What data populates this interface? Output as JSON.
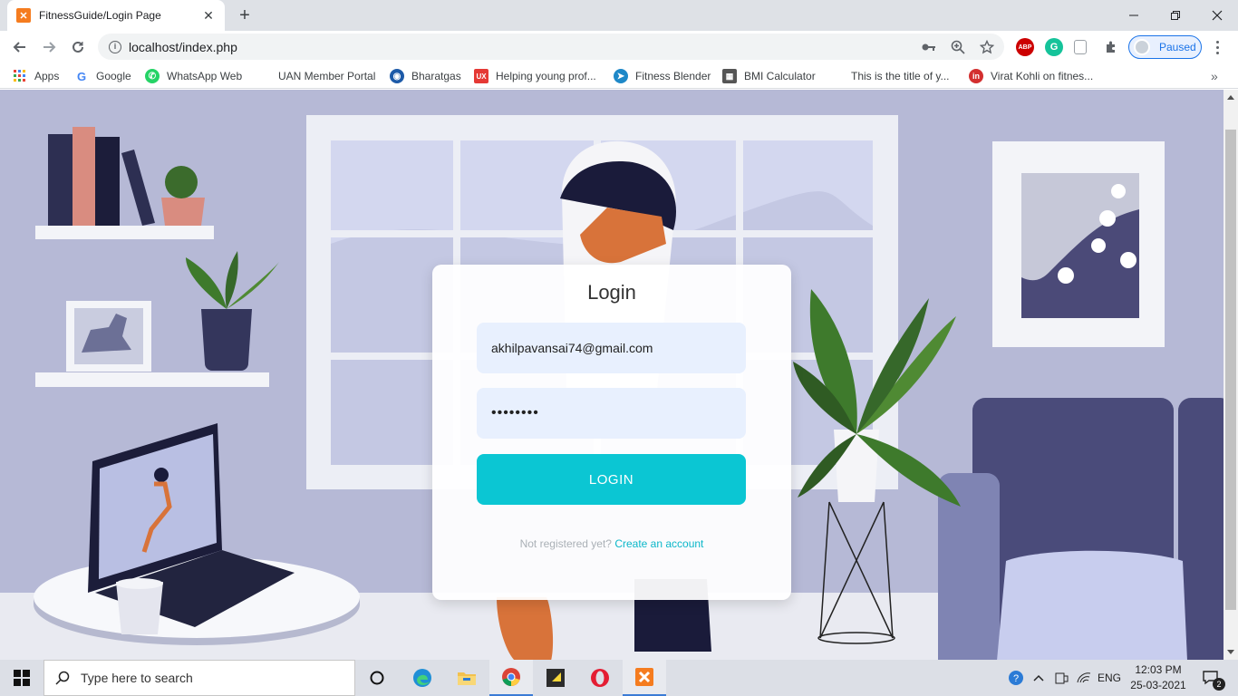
{
  "browser": {
    "tab_title": "FitnessGuide/Login Page",
    "tab_favicon": "xampp-icon",
    "url": "localhost/index.php",
    "profile_status": "Paused",
    "extensions": [
      "abp-icon",
      "grammarly-icon",
      "clipboard-icon",
      "puzzle-icon"
    ]
  },
  "bookmarks": [
    {
      "label": "Apps",
      "icon": "apps-grid-icon"
    },
    {
      "label": "Google",
      "icon": "google-icon"
    },
    {
      "label": "WhatsApp Web",
      "icon": "whatsapp-icon"
    },
    {
      "label": "UAN Member Portal",
      "icon": "blank-icon"
    },
    {
      "label": "Bharatgas",
      "icon": "bharatgas-icon"
    },
    {
      "label": "Helping young prof...",
      "icon": "ux-icon"
    },
    {
      "label": "Fitness Blender",
      "icon": "fitness-blender-icon"
    },
    {
      "label": "BMI Calculator",
      "icon": "calculator-icon"
    },
    {
      "label": "This is the title of y...",
      "icon": "blank-icon"
    },
    {
      "label": "Virat Kohli on fitnes...",
      "icon": "inshorts-icon"
    }
  ],
  "login": {
    "title": "Login",
    "email_value": "akhilpavansai74@gmail.com",
    "password_value": "••••••••",
    "button_label": "LOGIN",
    "register_prompt": "Not registered yet?",
    "register_link": "Create an account"
  },
  "taskbar": {
    "search_placeholder": "Type here to search",
    "language": "ENG",
    "time": "12:03 PM",
    "date": "25-03-2021",
    "notification_count": "2"
  },
  "colors": {
    "accent": "#0bc6d3",
    "input_bg": "#e8f0fe",
    "scene_wall": "#b6b9d6"
  }
}
